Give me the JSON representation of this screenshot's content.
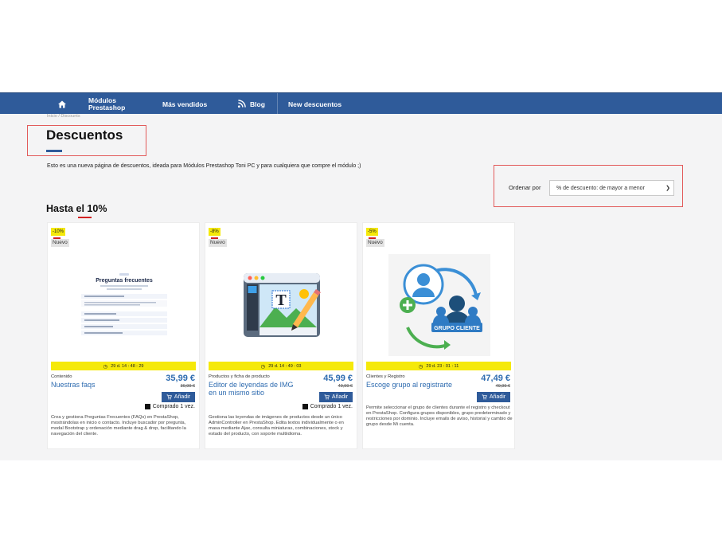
{
  "nav": {
    "modulos_line1": "Módulos",
    "modulos_line2": "Prestashop",
    "mas_vendidos": "Más vendidos",
    "blog": "Blog",
    "new_discounts": "New descuentos"
  },
  "breadcrumb": "Inicio / Discounts",
  "page": {
    "title": "Descuentos",
    "description": "Esto es una nueva página de descuentos, ideada para Módulos Prestashop Toni PC y para cualquiera que compre el módulo ;)"
  },
  "sort": {
    "label": "Ordenar por",
    "selected": "% de descuento: de mayor a menor"
  },
  "section": {
    "title": "Hasta el 10%"
  },
  "products": [
    {
      "badge": "-10%",
      "new_label": "Nuevo",
      "countdown": "29 d. 14 : 48 : 29",
      "category": "Contenido",
      "name": "Nuestras faqs",
      "price": "35,99 €",
      "old_price": "39,99 €",
      "add_label": "Añadir",
      "bought": "Comprado 1 vez.",
      "description": "Crea y gestiona Preguntas Frecuentes (FAQs) en PrestaShop, mostrándolas en inicio o contacto. Incluye buscador por pregunta, modal Bootstrap y ordenación mediante drag & drop, facilitando la navegación del cliente.",
      "image_title": "Preguntas frecuentes"
    },
    {
      "badge": "-8%",
      "new_label": "Nuevo",
      "countdown": "29 d. 14 : 49 : 03",
      "category": "Productos y ficha de producto",
      "name": "Editor de leyendas de IMG en un mismo sitio",
      "price": "45,99 €",
      "old_price": "49,99 €",
      "add_label": "Añadir",
      "bought": "Comprado 1 vez.",
      "description": "Gestiona las leyendas de imágenes de productos desde un único AdminController en PrestaShop. Edita textos individualmente o en masa mediante Ajax, consulta miniaturas, combinaciones, stock y estado del producto, con soporte multiidioma."
    },
    {
      "badge": "-5%",
      "new_label": "Nuevo",
      "countdown": "29 d. 23 : 01 : 11",
      "category": "Clientes y Registro",
      "name": "Escoge grupo al registrarte",
      "price": "47,49 €",
      "old_price": "49,99 €",
      "add_label": "Añadir",
      "description": "Permite seleccionar el grupo de clientes durante el registro y checkout en PrestaShop. Configura grupos disponibles, grupo predeterminado y restricciones por dominio. Incluye emails de aviso, historial y cambio de grupo desde Mi cuenta.",
      "image_label": "GRUPO CLIENTE"
    }
  ],
  "colors": {
    "nav_bg": "#2f5b9a",
    "price": "#2f6cb0",
    "badge": "#f5e90a",
    "accent_red": "#d32121"
  }
}
